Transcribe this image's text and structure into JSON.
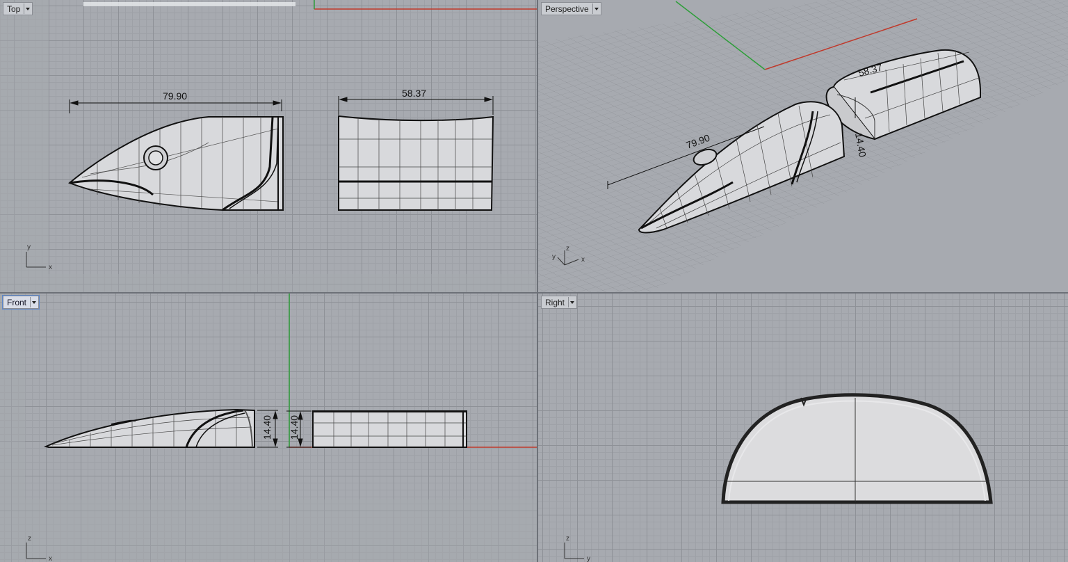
{
  "viewports": {
    "top": {
      "label": "Top"
    },
    "perspective": {
      "label": "Perspective"
    },
    "front": {
      "label": "Front"
    },
    "right": {
      "label": "Right"
    }
  },
  "dimensions": {
    "head_length": "79.90",
    "body_length": "58.37",
    "height_a": "14.40",
    "height_b": "14.40",
    "persp_head_length": "79.90",
    "persp_body_length": "58.37",
    "persp_height": "14.40"
  },
  "axes": {
    "x": "x",
    "y": "y",
    "z": "z"
  },
  "colors": {
    "x_axis": "#c0392b",
    "y_axis": "#2e9e3a",
    "grid": "#8e9197",
    "background": "#a7aab0"
  }
}
